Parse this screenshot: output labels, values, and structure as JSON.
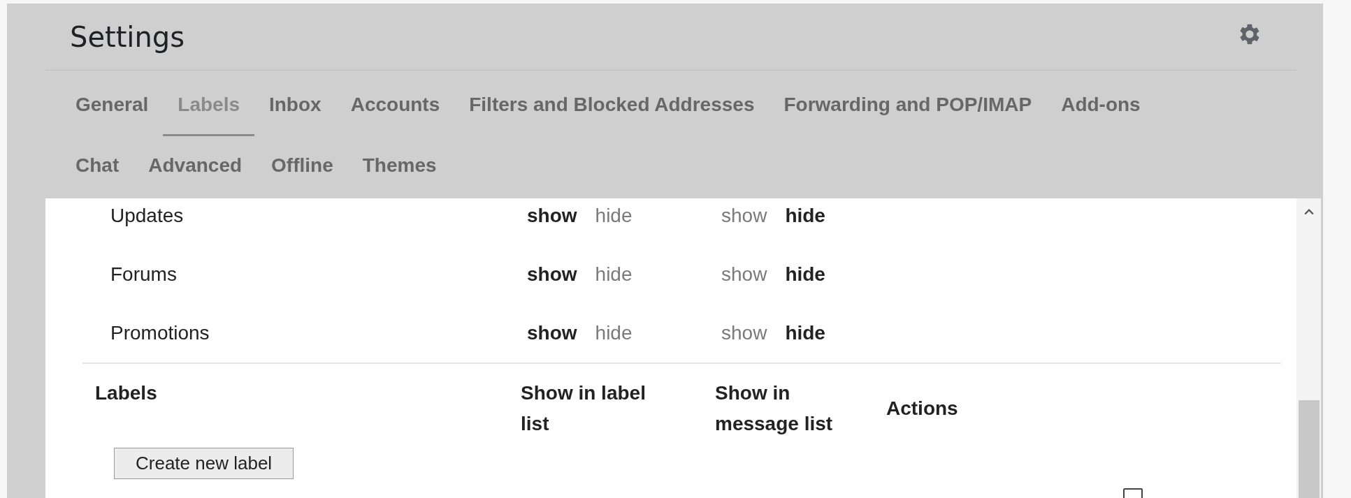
{
  "title": "Settings",
  "tabs": [
    {
      "label": "General",
      "selected": false
    },
    {
      "label": "Labels",
      "selected": true
    },
    {
      "label": "Inbox",
      "selected": false
    },
    {
      "label": "Accounts",
      "selected": false
    },
    {
      "label": "Filters and Blocked Addresses",
      "selected": false
    },
    {
      "label": "Forwarding and POP/IMAP",
      "selected": false
    },
    {
      "label": "Add-ons",
      "selected": false
    },
    {
      "label": "Chat",
      "selected": false
    },
    {
      "label": "Advanced",
      "selected": false
    },
    {
      "label": "Offline",
      "selected": false
    },
    {
      "label": "Themes",
      "selected": false
    }
  ],
  "category_rows": [
    {
      "name": "Updates",
      "label_list": [
        {
          "text": "show",
          "selected": true
        },
        {
          "text": "hide",
          "selected": false
        }
      ],
      "message_list": [
        {
          "text": "show",
          "selected": false
        },
        {
          "text": "hide",
          "selected": true
        }
      ]
    },
    {
      "name": "Forums",
      "label_list": [
        {
          "text": "show",
          "selected": true
        },
        {
          "text": "hide",
          "selected": false
        }
      ],
      "message_list": [
        {
          "text": "show",
          "selected": false
        },
        {
          "text": "hide",
          "selected": true
        }
      ]
    },
    {
      "name": "Promotions",
      "label_list": [
        {
          "text": "show",
          "selected": true
        },
        {
          "text": "hide",
          "selected": false
        }
      ],
      "message_list": [
        {
          "text": "show",
          "selected": false
        },
        {
          "text": "hide",
          "selected": true
        }
      ]
    }
  ],
  "labels_table": {
    "columns": [
      "Labels",
      "Show in label list",
      "Show in message list",
      "Actions"
    ],
    "create_button": "Create new label"
  }
}
